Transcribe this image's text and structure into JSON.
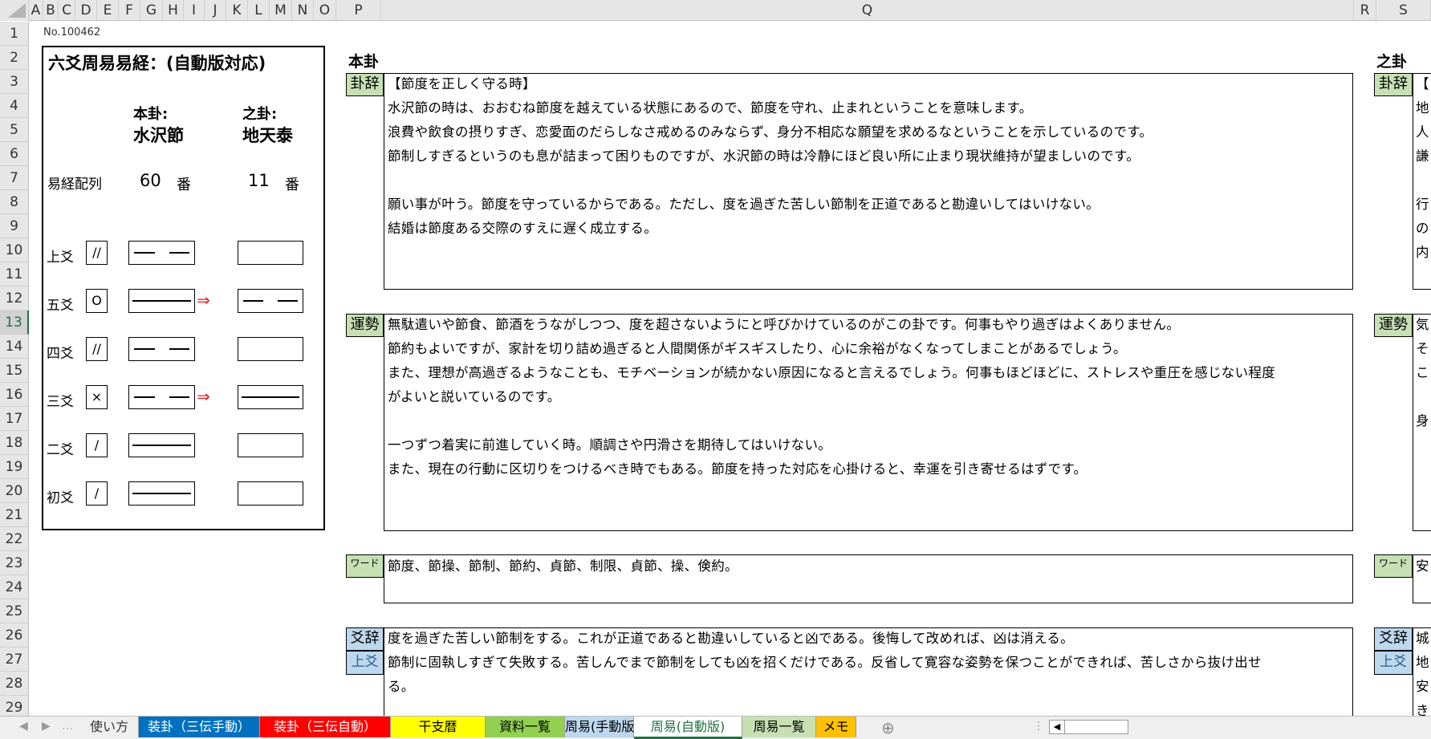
{
  "columns": [
    "A",
    "B",
    "C",
    "D",
    "E",
    "F",
    "G",
    "H",
    "I",
    "J",
    "K",
    "L",
    "M",
    "N",
    "O",
    "P",
    "Q",
    "R",
    "S"
  ],
  "rows": [
    "1",
    "2",
    "3",
    "4",
    "5",
    "6",
    "7",
    "8",
    "9",
    "10",
    "11",
    "12",
    "13",
    "14",
    "15",
    "16",
    "17",
    "18",
    "19",
    "20",
    "21",
    "22",
    "23",
    "24",
    "25",
    "26",
    "27",
    "28",
    "29"
  ],
  "selected_row": "13",
  "doc_no": "No.100462",
  "panel": {
    "title": "六爻周易易経：(自動版対応)",
    "hon_label": "本卦:",
    "hon_name": "水沢節",
    "shi_label": "之卦:",
    "shi_name": "地天泰",
    "order_label": "易経配列",
    "hon_num": "60",
    "shi_num": "11",
    "ban": "番",
    "lines": [
      {
        "name": "上爻",
        "mark": "//",
        "hon": "yin",
        "arrow": "",
        "shi": ""
      },
      {
        "name": "五爻",
        "mark": "O",
        "hon": "yang",
        "arrow": "⇒",
        "shi": "yin"
      },
      {
        "name": "四爻",
        "mark": "//",
        "hon": "yin",
        "arrow": "",
        "shi": ""
      },
      {
        "name": "三爻",
        "mark": "×",
        "hon": "yin",
        "arrow": "⇒",
        "shi": "yang"
      },
      {
        "name": "二爻",
        "mark": "/",
        "hon": "yang",
        "arrow": "",
        "shi": ""
      },
      {
        "name": "初爻",
        "mark": "/",
        "hon": "yang",
        "arrow": "",
        "shi": ""
      }
    ]
  },
  "honka": {
    "heading": "本卦",
    "kaji_label": "卦辞",
    "kaji_lines": [
      "【節度を正しく守る時】",
      "水沢節の時は、おおむね節度を越えている状態にあるので、節度を守れ、止まれということを意味します。",
      "浪費や飲食の摂りすぎ、恋愛面のだらしなさ戒めるのみならず、身分不相応な願望を求めるなということを示しているのです。",
      "節制しすぎるというのも息が詰まって困りものですが、水沢節の時は冷静にほど良い所に止まり現状維持が望ましいのです。",
      "",
      "願い事が叶う。節度を守っているからである。ただし、度を過ぎた苦しい節制を正道であると勘違いしてはいけない。",
      "結婚は節度ある交際のすえに遅く成立する。"
    ],
    "unsei_label": "運勢",
    "unsei_lines": [
      "無駄遣いや節食、節酒をうながしつつ、度を超さないようにと呼びかけているのがこの卦です。何事もやり過ぎはよくありません。",
      "節約もよいですが、家計を切り詰め過ぎると人間関係がギスギスしたり、心に余裕がなくなってしまことがあるでしょう。",
      "また、理想が高過ぎるようなことも、モチベーションが続かない原因になると言えるでしょう。何事もほどほどに、ストレスや重圧を感じない程度",
      "がよいと説いているのです。",
      "",
      "一つずつ着実に前進していく時。順調さや円滑さを期待してはいけない。",
      "また、現在の行動に区切りをつけるべき時でもある。節度を持った対応を心掛けると、幸運を引き寄せるはずです。"
    ],
    "word_label": "ワード",
    "word_text": "節度、節操、節制、節約、貞節、制限、貞節、操、倹約。",
    "kouji_label": "爻辞",
    "kouji_sub": "上爻",
    "kouji_lines": [
      "度を過ぎた苦しい節制をする。これが正道であると勘違いしていると凶である。後悔して改めれば、凶は消える。",
      "節制に固執しすぎて失敗する。苦しんでまで節制をしても凶を招くだけである。反省して寛容な姿勢を保つことができれば、苦しさから抜け出せ",
      "る。"
    ]
  },
  "shika": {
    "heading": "之卦",
    "kaji_label": "卦辞",
    "kaji_chars": [
      "【",
      "地",
      "人",
      "謙",
      "",
      "行",
      "の",
      "内"
    ],
    "unsei_label": "運勢",
    "unsei_chars": [
      "気",
      "そ",
      "こ",
      "",
      "身"
    ],
    "word_label": "ワード",
    "word_char": "安",
    "kouji_label": "爻辞",
    "kouji_sub": "上爻",
    "kouji_chars": [
      "城",
      "地",
      "安",
      "き"
    ]
  },
  "tabs": [
    {
      "label": "使い方",
      "bg": "#efefef",
      "color": "#333333"
    },
    {
      "label": "装卦（三伝手動）",
      "bg": "#0070c0",
      "color": "#ffffff"
    },
    {
      "label": "装卦（三伝自動）",
      "bg": "#ff0000",
      "color": "#ffffff"
    },
    {
      "label": "干支暦",
      "bg": "#ffff00",
      "color": "#000000"
    },
    {
      "label": "資料一覧",
      "bg": "#92d050",
      "color": "#000000"
    },
    {
      "label": "周易(手動版)",
      "bg": "#bdd7ee",
      "color": "#000000"
    },
    {
      "label": "周易(自動版)",
      "bg": "#ffffff",
      "color": "#1e7145"
    },
    {
      "label": "周易一覧",
      "bg": "#c6e0b4",
      "color": "#000000"
    },
    {
      "label": "メモ",
      "bg": "#ffc000",
      "color": "#000000"
    }
  ],
  "active_tab": "周易(自動版)",
  "add_sheet_glyph": "⊕"
}
